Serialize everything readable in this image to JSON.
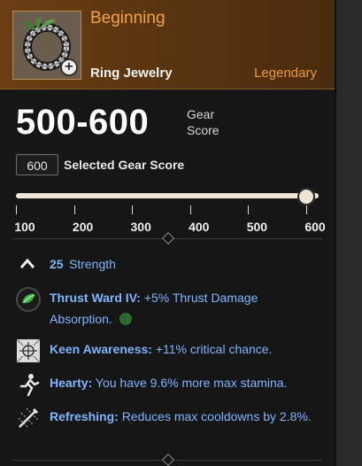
{
  "item": {
    "name": "Beginning",
    "type": "Ring Jewelry",
    "rarity": "Legendary",
    "icon": "ring-icon",
    "colors": {
      "rarity": "#ee9a3d",
      "header_bg": "#5a3510",
      "perk_text": "#7fb4ff"
    }
  },
  "gear_score": {
    "range": "500-600",
    "label": "Gear Score",
    "selected_value": "600",
    "selected_label": "Selected Gear Score",
    "slider": {
      "min": 100,
      "max": 600,
      "value": 600
    },
    "ticks": [
      "100",
      "200",
      "300",
      "400",
      "500",
      "600"
    ]
  },
  "attributes": [
    {
      "value": "25",
      "name": "Strength",
      "icon": "chevron-up-icon"
    }
  ],
  "perks": [
    {
      "name": "Thrust Ward IV:",
      "desc": "+5% Thrust Damage Absorption.",
      "icon": "green-gem-icon",
      "socket_icon": "gem-socket-icon"
    },
    {
      "name": "Keen Awareness:",
      "desc": "+11% critical chance.",
      "icon": "crosshair-icon"
    },
    {
      "name": "Hearty:",
      "desc": "You have 9.6% more max stamina.",
      "icon": "running-figure-icon"
    },
    {
      "name": "Refreshing:",
      "desc": "Reduces max cooldowns by 2.8%.",
      "icon": "sword-slash-icon"
    }
  ]
}
